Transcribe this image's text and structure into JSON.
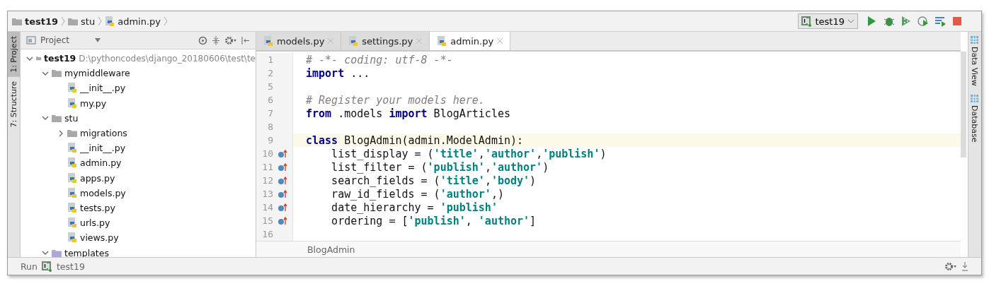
{
  "breadcrumb": [
    {
      "label": "test19",
      "kind": "folder"
    },
    {
      "label": "stu",
      "kind": "folder"
    },
    {
      "label": "admin.py",
      "kind": "python"
    }
  ],
  "run_config": {
    "label": "test19"
  },
  "left_strip": [
    {
      "label": "1: Project",
      "selected": true
    },
    {
      "label": "7: Structure",
      "selected": false
    }
  ],
  "project_panel": {
    "title": "Project",
    "tree": [
      {
        "label": "test19",
        "path": "D:\\pythoncodes\\django_20180606\\test\\te",
        "kind": "folder",
        "expanded": true,
        "children": [
          {
            "label": "mymiddleware",
            "kind": "folder",
            "expanded": true,
            "children": [
              {
                "label": "__init__.py",
                "kind": "python"
              },
              {
                "label": "my.py",
                "kind": "python"
              }
            ]
          },
          {
            "label": "stu",
            "kind": "folder",
            "expanded": true,
            "children": [
              {
                "label": "migrations",
                "kind": "folder",
                "expanded": false
              },
              {
                "label": "__init__.py",
                "kind": "python"
              },
              {
                "label": "admin.py",
                "kind": "python"
              },
              {
                "label": "apps.py",
                "kind": "python"
              },
              {
                "label": "models.py",
                "kind": "python"
              },
              {
                "label": "tests.py",
                "kind": "python"
              },
              {
                "label": "urls.py",
                "kind": "python"
              },
              {
                "label": "views.py",
                "kind": "python"
              }
            ]
          },
          {
            "label": "templates",
            "kind": "template",
            "expanded": true
          }
        ]
      }
    ]
  },
  "tabs": [
    {
      "label": "models.py",
      "selected": false
    },
    {
      "label": "settings.py",
      "selected": false
    },
    {
      "label": "admin.py",
      "selected": true
    }
  ],
  "editor": {
    "lines": [
      {
        "number": "1",
        "override": false,
        "current": false,
        "tokens": [
          {
            "kind": "comment",
            "text": "# -*- coding: utf-8 -*-"
          }
        ]
      },
      {
        "number": "2",
        "override": false,
        "current": false,
        "tokens": [
          {
            "kind": "keyword",
            "text": "import"
          },
          {
            "kind": "plain",
            "text": " ..."
          }
        ]
      },
      {
        "number": "5",
        "override": false,
        "current": false
      },
      {
        "number": "6",
        "override": false,
        "current": false,
        "tokens": [
          {
            "kind": "comment",
            "text": "# Register your models here."
          }
        ]
      },
      {
        "number": "7",
        "override": false,
        "current": false,
        "tokens": [
          {
            "kind": "keyword",
            "text": "from"
          },
          {
            "kind": "plain",
            "text": " .models "
          },
          {
            "kind": "keyword",
            "text": "import"
          },
          {
            "kind": "plain",
            "text": " BlogArticles"
          }
        ]
      },
      {
        "number": "8",
        "override": false,
        "current": false
      },
      {
        "number": "9",
        "override": false,
        "current": true,
        "tokens": [
          {
            "kind": "keyword",
            "text": "class"
          },
          {
            "kind": "plain",
            "text": " BlogAdmin(admin.ModelAdmin):"
          }
        ]
      },
      {
        "number": "10",
        "override": true,
        "current": false,
        "tokens": [
          {
            "kind": "plain",
            "text": "    list_display = ("
          },
          {
            "kind": "string",
            "text": "'title'"
          },
          {
            "kind": "plain",
            "text": ","
          },
          {
            "kind": "string",
            "text": "'author'"
          },
          {
            "kind": "plain",
            "text": ","
          },
          {
            "kind": "string",
            "text": "'publish'"
          },
          {
            "kind": "plain",
            "text": ")"
          }
        ]
      },
      {
        "number": "11",
        "override": true,
        "current": false,
        "tokens": [
          {
            "kind": "plain",
            "text": "    list_filter = ("
          },
          {
            "kind": "string",
            "text": "'publish'"
          },
          {
            "kind": "plain",
            "text": ","
          },
          {
            "kind": "string",
            "text": "'author'"
          },
          {
            "kind": "plain",
            "text": ")"
          }
        ]
      },
      {
        "number": "12",
        "override": true,
        "current": false,
        "tokens": [
          {
            "kind": "plain",
            "text": "    search_fields = ("
          },
          {
            "kind": "string",
            "text": "'title'"
          },
          {
            "kind": "plain",
            "text": ","
          },
          {
            "kind": "string",
            "text": "'body'"
          },
          {
            "kind": "plain",
            "text": ")"
          }
        ]
      },
      {
        "number": "13",
        "override": true,
        "current": false,
        "tokens": [
          {
            "kind": "plain",
            "text": "    raw_id_fields = ("
          },
          {
            "kind": "string",
            "text": "'author'"
          },
          {
            "kind": "plain",
            "text": ",)"
          }
        ]
      },
      {
        "number": "14",
        "override": true,
        "current": false,
        "tokens": [
          {
            "kind": "plain",
            "text": "    date_hierarchy = "
          },
          {
            "kind": "string",
            "text": "'publish'"
          }
        ]
      },
      {
        "number": "15",
        "override": true,
        "current": false,
        "tokens": [
          {
            "kind": "plain",
            "text": "    ordering = ["
          },
          {
            "kind": "string",
            "text": "'publish'"
          },
          {
            "kind": "plain",
            "text": ", "
          },
          {
            "kind": "string",
            "text": "'author'"
          },
          {
            "kind": "plain",
            "text": "]"
          }
        ]
      },
      {
        "number": "16",
        "override": false,
        "current": false
      }
    ],
    "breadcrumb": "BlogAdmin"
  },
  "right_strip": [
    {
      "label": "Data View"
    },
    {
      "label": "Database"
    }
  ],
  "run_bar": {
    "label": "Run",
    "config": "test19"
  }
}
